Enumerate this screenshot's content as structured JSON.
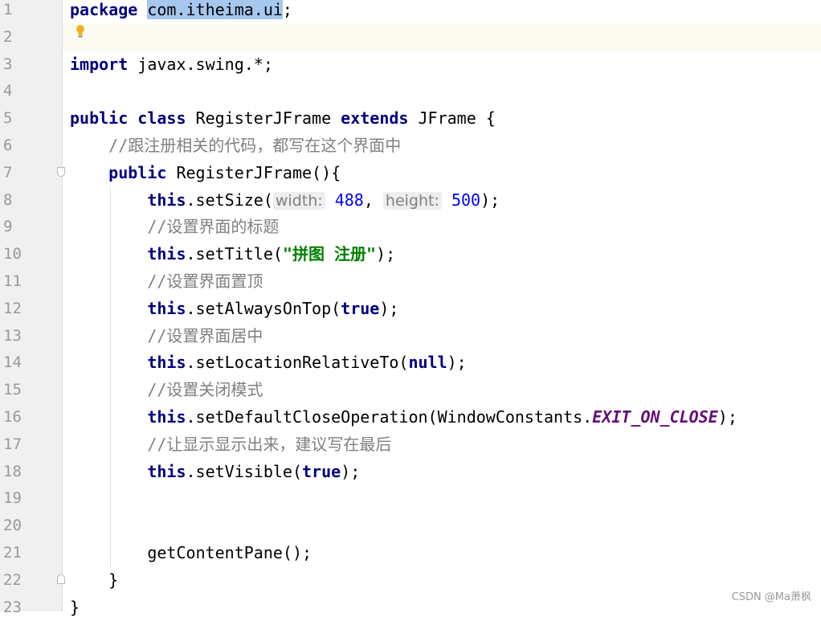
{
  "editor": {
    "lines": [
      {
        "n": "1",
        "tokens": [
          [
            "kw",
            "package"
          ],
          [
            "t",
            " "
          ],
          [
            "sel",
            "com.itheima.ui"
          ],
          [
            "t",
            ";"
          ]
        ]
      },
      {
        "n": "2",
        "tokens": []
      },
      {
        "n": "3",
        "tokens": [
          [
            "kw",
            "import"
          ],
          [
            "t",
            " javax.swing.*;"
          ]
        ]
      },
      {
        "n": "4",
        "tokens": []
      },
      {
        "n": "5",
        "tokens": [
          [
            "kw",
            "public"
          ],
          [
            "t",
            " "
          ],
          [
            "kw",
            "class"
          ],
          [
            "t",
            " RegisterJFrame "
          ],
          [
            "kw",
            "extends"
          ],
          [
            "t",
            " JFrame {"
          ]
        ]
      },
      {
        "n": "6",
        "tokens": [
          [
            "t",
            "    "
          ],
          [
            "cm",
            "//"
          ],
          [
            "cmcn",
            "跟注册相关的代码，都写在这个界面中"
          ]
        ]
      },
      {
        "n": "7",
        "tokens": [
          [
            "t",
            "    "
          ],
          [
            "kw",
            "public"
          ],
          [
            "t",
            " RegisterJFrame(){"
          ]
        ]
      },
      {
        "n": "8",
        "tokens": [
          [
            "t",
            "        "
          ],
          [
            "kw",
            "this"
          ],
          [
            "t",
            ".setSize("
          ],
          [
            "hint",
            "width:"
          ],
          [
            "t",
            " "
          ],
          [
            "num",
            "488"
          ],
          [
            "t",
            ", "
          ],
          [
            "hint",
            "height:"
          ],
          [
            "t",
            " "
          ],
          [
            "num",
            "500"
          ],
          [
            "t",
            ");"
          ]
        ]
      },
      {
        "n": "9",
        "tokens": [
          [
            "t",
            "        "
          ],
          [
            "cm",
            "//"
          ],
          [
            "cmcn",
            "设置界面的标题"
          ]
        ]
      },
      {
        "n": "10",
        "tokens": [
          [
            "t",
            "        "
          ],
          [
            "kw",
            "this"
          ],
          [
            "t",
            ".setTitle("
          ],
          [
            "str",
            "\"拼图 注册\""
          ],
          [
            "t",
            ");"
          ]
        ]
      },
      {
        "n": "11",
        "tokens": [
          [
            "t",
            "        "
          ],
          [
            "cm",
            "//"
          ],
          [
            "cmcn",
            "设置界面置顶"
          ]
        ]
      },
      {
        "n": "12",
        "tokens": [
          [
            "t",
            "        "
          ],
          [
            "kw",
            "this"
          ],
          [
            "t",
            ".setAlwaysOnTop("
          ],
          [
            "kw",
            "true"
          ],
          [
            "t",
            ");"
          ]
        ]
      },
      {
        "n": "13",
        "tokens": [
          [
            "t",
            "        "
          ],
          [
            "cm",
            "//"
          ],
          [
            "cmcn",
            "设置界面居中"
          ]
        ]
      },
      {
        "n": "14",
        "tokens": [
          [
            "t",
            "        "
          ],
          [
            "kw",
            "this"
          ],
          [
            "t",
            ".setLocationRelativeTo("
          ],
          [
            "kw",
            "null"
          ],
          [
            "t",
            ");"
          ]
        ]
      },
      {
        "n": "15",
        "tokens": [
          [
            "t",
            "        "
          ],
          [
            "cm",
            "//"
          ],
          [
            "cmcn",
            "设置关闭模式"
          ]
        ]
      },
      {
        "n": "16",
        "tokens": [
          [
            "t",
            "        "
          ],
          [
            "kw",
            "this"
          ],
          [
            "t",
            ".setDefaultCloseOperation(WindowConstants."
          ],
          [
            "const",
            "EXIT_ON_CLOSE"
          ],
          [
            "t",
            ");"
          ]
        ]
      },
      {
        "n": "17",
        "tokens": [
          [
            "t",
            "        "
          ],
          [
            "cm",
            "//"
          ],
          [
            "cmcn",
            "让显示显示出来，建议写在最后"
          ]
        ]
      },
      {
        "n": "18",
        "tokens": [
          [
            "t",
            "        "
          ],
          [
            "kw",
            "this"
          ],
          [
            "t",
            ".setVisible("
          ],
          [
            "kw",
            "true"
          ],
          [
            "t",
            ");"
          ]
        ]
      },
      {
        "n": "19",
        "tokens": []
      },
      {
        "n": "20",
        "tokens": []
      },
      {
        "n": "21",
        "tokens": [
          [
            "t",
            "        getContentPane();"
          ]
        ]
      },
      {
        "n": "22",
        "tokens": [
          [
            "t",
            "    }"
          ]
        ]
      },
      {
        "n": "23",
        "tokens": [
          [
            "t",
            "}"
          ]
        ]
      }
    ],
    "highlighted_line": 2,
    "accent_colors": {
      "keyword": "#000080",
      "comment": "#808080",
      "string": "#008000",
      "number": "#0000ff",
      "constant": "#660e7a",
      "selection": "#a6c7ee"
    },
    "icons": [
      "lightbulb-icon",
      "fold-open-icon",
      "fold-close-icon"
    ]
  },
  "watermark": "CSDN @Ma萧枫"
}
